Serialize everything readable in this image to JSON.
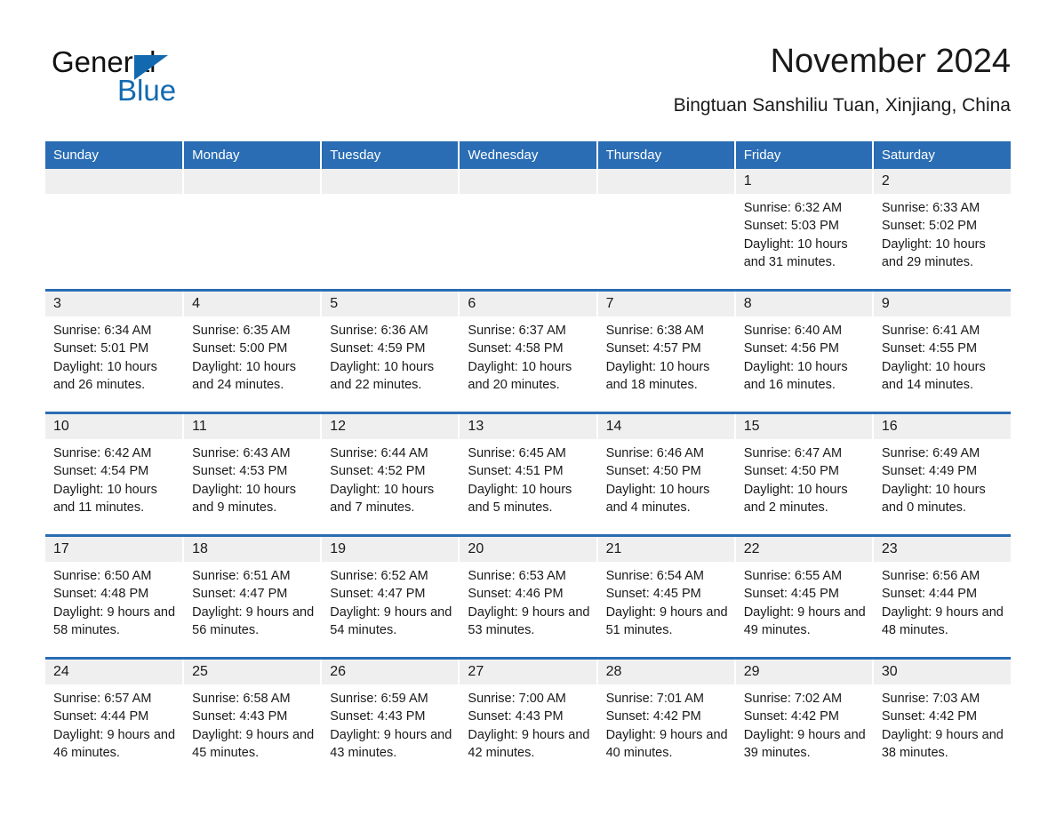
{
  "brand": {
    "name_part1": "General",
    "name_part2": "Blue",
    "triangle_color": "#1369b0",
    "text_color": "#111111"
  },
  "header": {
    "title": "November 2024",
    "subtitle": "Bingtuan Sanshiliu Tuan, Xinjiang, China"
  },
  "theme": {
    "header_blue": "#2a6db4",
    "daynum_band": "#efefef",
    "cell_background": "#ffffff",
    "text_color": "#1a1a1a"
  },
  "weekday_headers": [
    "Sunday",
    "Monday",
    "Tuesday",
    "Wednesday",
    "Thursday",
    "Friday",
    "Saturday"
  ],
  "weeks": [
    [
      {
        "day": "",
        "empty": true
      },
      {
        "day": "",
        "empty": true
      },
      {
        "day": "",
        "empty": true
      },
      {
        "day": "",
        "empty": true
      },
      {
        "day": "",
        "empty": true
      },
      {
        "day": "1",
        "sunrise": "Sunrise: 6:32 AM",
        "sunset": "Sunset: 5:03 PM",
        "daylight": "Daylight: 10 hours and 31 minutes."
      },
      {
        "day": "2",
        "sunrise": "Sunrise: 6:33 AM",
        "sunset": "Sunset: 5:02 PM",
        "daylight": "Daylight: 10 hours and 29 minutes."
      }
    ],
    [
      {
        "day": "3",
        "sunrise": "Sunrise: 6:34 AM",
        "sunset": "Sunset: 5:01 PM",
        "daylight": "Daylight: 10 hours and 26 minutes."
      },
      {
        "day": "4",
        "sunrise": "Sunrise: 6:35 AM",
        "sunset": "Sunset: 5:00 PM",
        "daylight": "Daylight: 10 hours and 24 minutes."
      },
      {
        "day": "5",
        "sunrise": "Sunrise: 6:36 AM",
        "sunset": "Sunset: 4:59 PM",
        "daylight": "Daylight: 10 hours and 22 minutes."
      },
      {
        "day": "6",
        "sunrise": "Sunrise: 6:37 AM",
        "sunset": "Sunset: 4:58 PM",
        "daylight": "Daylight: 10 hours and 20 minutes."
      },
      {
        "day": "7",
        "sunrise": "Sunrise: 6:38 AM",
        "sunset": "Sunset: 4:57 PM",
        "daylight": "Daylight: 10 hours and 18 minutes."
      },
      {
        "day": "8",
        "sunrise": "Sunrise: 6:40 AM",
        "sunset": "Sunset: 4:56 PM",
        "daylight": "Daylight: 10 hours and 16 minutes."
      },
      {
        "day": "9",
        "sunrise": "Sunrise: 6:41 AM",
        "sunset": "Sunset: 4:55 PM",
        "daylight": "Daylight: 10 hours and 14 minutes."
      }
    ],
    [
      {
        "day": "10",
        "sunrise": "Sunrise: 6:42 AM",
        "sunset": "Sunset: 4:54 PM",
        "daylight": "Daylight: 10 hours and 11 minutes."
      },
      {
        "day": "11",
        "sunrise": "Sunrise: 6:43 AM",
        "sunset": "Sunset: 4:53 PM",
        "daylight": "Daylight: 10 hours and 9 minutes."
      },
      {
        "day": "12",
        "sunrise": "Sunrise: 6:44 AM",
        "sunset": "Sunset: 4:52 PM",
        "daylight": "Daylight: 10 hours and 7 minutes."
      },
      {
        "day": "13",
        "sunrise": "Sunrise: 6:45 AM",
        "sunset": "Sunset: 4:51 PM",
        "daylight": "Daylight: 10 hours and 5 minutes."
      },
      {
        "day": "14",
        "sunrise": "Sunrise: 6:46 AM",
        "sunset": "Sunset: 4:50 PM",
        "daylight": "Daylight: 10 hours and 4 minutes."
      },
      {
        "day": "15",
        "sunrise": "Sunrise: 6:47 AM",
        "sunset": "Sunset: 4:50 PM",
        "daylight": "Daylight: 10 hours and 2 minutes."
      },
      {
        "day": "16",
        "sunrise": "Sunrise: 6:49 AM",
        "sunset": "Sunset: 4:49 PM",
        "daylight": "Daylight: 10 hours and 0 minutes."
      }
    ],
    [
      {
        "day": "17",
        "sunrise": "Sunrise: 6:50 AM",
        "sunset": "Sunset: 4:48 PM",
        "daylight": "Daylight: 9 hours and 58 minutes."
      },
      {
        "day": "18",
        "sunrise": "Sunrise: 6:51 AM",
        "sunset": "Sunset: 4:47 PM",
        "daylight": "Daylight: 9 hours and 56 minutes."
      },
      {
        "day": "19",
        "sunrise": "Sunrise: 6:52 AM",
        "sunset": "Sunset: 4:47 PM",
        "daylight": "Daylight: 9 hours and 54 minutes."
      },
      {
        "day": "20",
        "sunrise": "Sunrise: 6:53 AM",
        "sunset": "Sunset: 4:46 PM",
        "daylight": "Daylight: 9 hours and 53 minutes."
      },
      {
        "day": "21",
        "sunrise": "Sunrise: 6:54 AM",
        "sunset": "Sunset: 4:45 PM",
        "daylight": "Daylight: 9 hours and 51 minutes."
      },
      {
        "day": "22",
        "sunrise": "Sunrise: 6:55 AM",
        "sunset": "Sunset: 4:45 PM",
        "daylight": "Daylight: 9 hours and 49 minutes."
      },
      {
        "day": "23",
        "sunrise": "Sunrise: 6:56 AM",
        "sunset": "Sunset: 4:44 PM",
        "daylight": "Daylight: 9 hours and 48 minutes."
      }
    ],
    [
      {
        "day": "24",
        "sunrise": "Sunrise: 6:57 AM",
        "sunset": "Sunset: 4:44 PM",
        "daylight": "Daylight: 9 hours and 46 minutes."
      },
      {
        "day": "25",
        "sunrise": "Sunrise: 6:58 AM",
        "sunset": "Sunset: 4:43 PM",
        "daylight": "Daylight: 9 hours and 45 minutes."
      },
      {
        "day": "26",
        "sunrise": "Sunrise: 6:59 AM",
        "sunset": "Sunset: 4:43 PM",
        "daylight": "Daylight: 9 hours and 43 minutes."
      },
      {
        "day": "27",
        "sunrise": "Sunrise: 7:00 AM",
        "sunset": "Sunset: 4:43 PM",
        "daylight": "Daylight: 9 hours and 42 minutes."
      },
      {
        "day": "28",
        "sunrise": "Sunrise: 7:01 AM",
        "sunset": "Sunset: 4:42 PM",
        "daylight": "Daylight: 9 hours and 40 minutes."
      },
      {
        "day": "29",
        "sunrise": "Sunrise: 7:02 AM",
        "sunset": "Sunset: 4:42 PM",
        "daylight": "Daylight: 9 hours and 39 minutes."
      },
      {
        "day": "30",
        "sunrise": "Sunrise: 7:03 AM",
        "sunset": "Sunset: 4:42 PM",
        "daylight": "Daylight: 9 hours and 38 minutes."
      }
    ]
  ]
}
